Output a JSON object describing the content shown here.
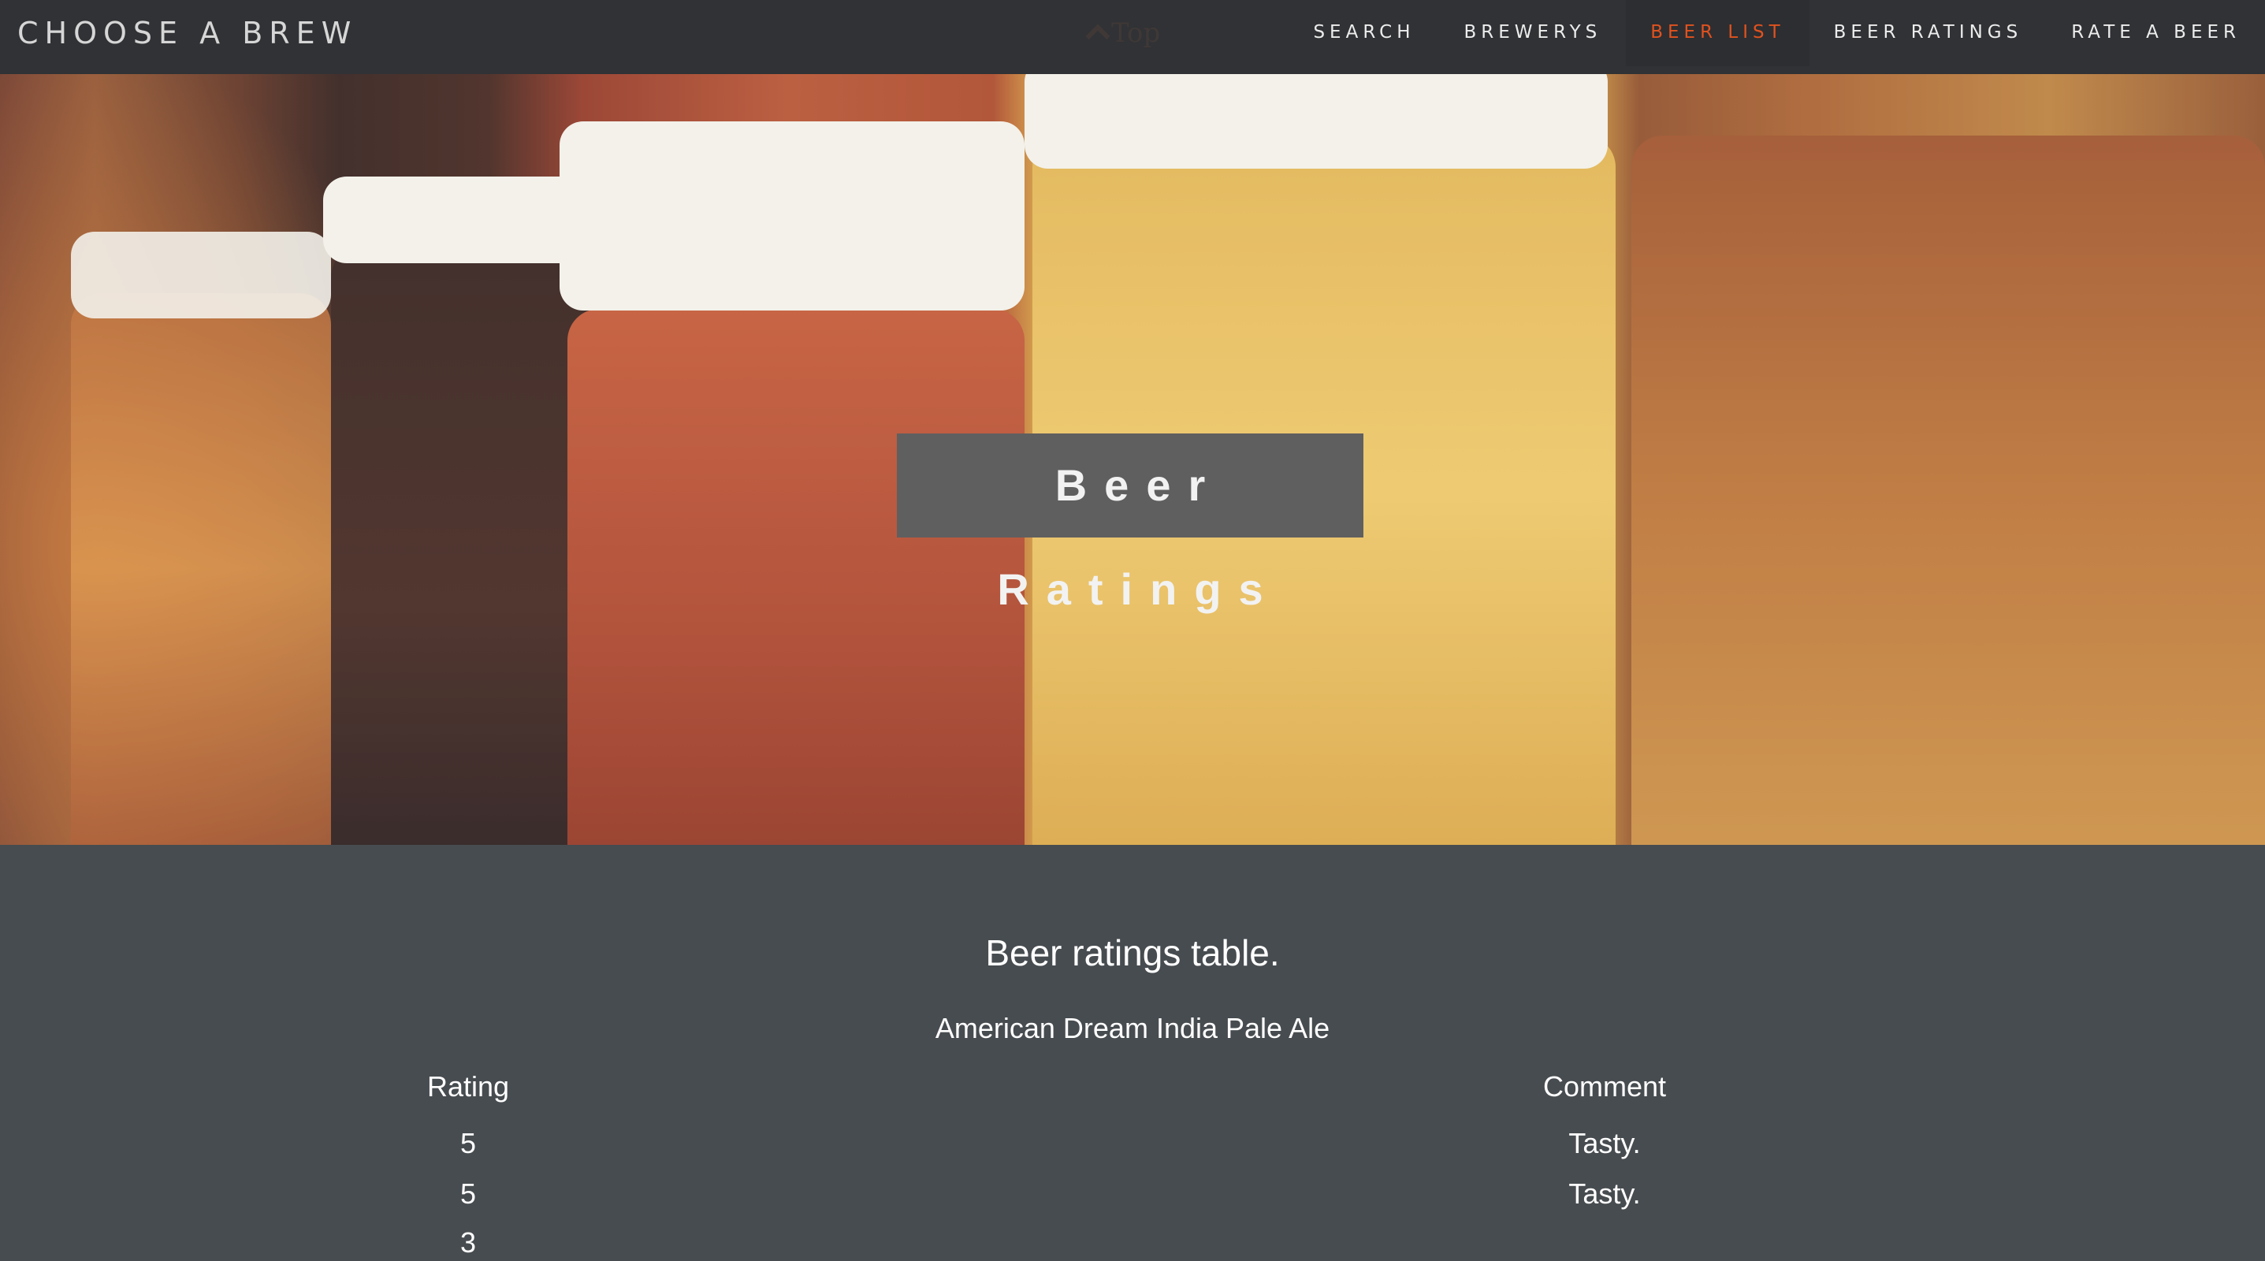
{
  "navbar": {
    "brand": "CHOOSE A BREW",
    "top_link": "Top",
    "items": [
      {
        "label": "SEARCH",
        "active": false
      },
      {
        "label": "BREWERYS",
        "active": false
      },
      {
        "label": "BEER LIST",
        "active": true
      },
      {
        "label": "BEER RATINGS",
        "active": false
      },
      {
        "label": "RATE A BEER",
        "active": false
      }
    ],
    "active_color": "#e0521f"
  },
  "hero": {
    "title": "Beer Ratings"
  },
  "ratings_table": {
    "title": "Beer ratings table.",
    "beer_name": "American Dream India Pale Ale",
    "columns": [
      "Rating",
      "Comment"
    ],
    "rows": [
      {
        "rating": "5",
        "comment": "Tasty."
      },
      {
        "rating": "5",
        "comment": "Tasty."
      },
      {
        "rating": "3",
        "comment": ""
      }
    ]
  }
}
